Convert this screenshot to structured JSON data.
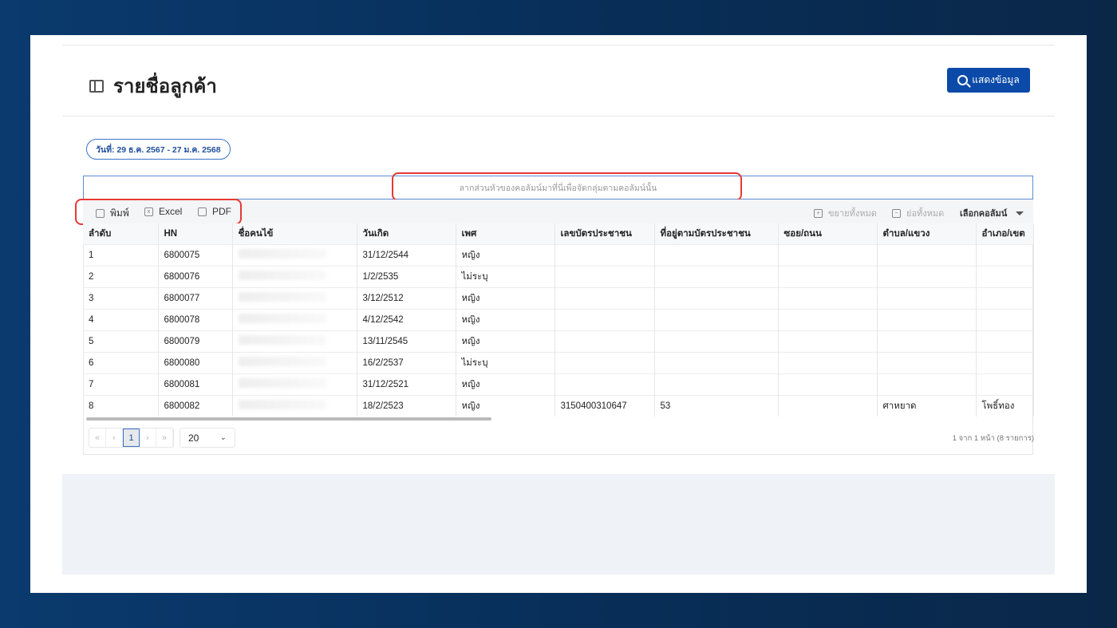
{
  "header": {
    "title": "รายชื่อลูกค้า",
    "show_button": "แสดงข้อมูล"
  },
  "date_range": "วันที่: 29 ธ.ค. 2567 - 27 ม.ค. 2568",
  "group_hint": "ลากส่วนหัวของคอลัมน์มาที่นี่เพื่อจัดกลุ่มตามคอลัมน์นั้น",
  "toolbar": {
    "print": "พิมพ์",
    "excel": "Excel",
    "pdf": "PDF",
    "expand_all": "ขยายทั้งหมด",
    "collapse_all": "ย่อทั้งหมด",
    "choose_columns": "เลือกคอลัมน์"
  },
  "columns": [
    "ลำดับ",
    "HN",
    "ชื่อคนไข้",
    "วันเกิด",
    "เพศ",
    "เลขบัตรประชาชน",
    "ที่อยู่ตามบัตรประชาชน",
    "ซอย/ถนน",
    "ตำบล/แขวง",
    "อำเภอ/เขต"
  ],
  "rows": [
    [
      "1",
      "6800075",
      "",
      "31/12/2544",
      "หญิง",
      "",
      "",
      "",
      "",
      ""
    ],
    [
      "2",
      "6800076",
      "",
      "1/2/2535",
      "ไม่ระบุ",
      "",
      "",
      "",
      "",
      ""
    ],
    [
      "3",
      "6800077",
      "",
      "3/12/2512",
      "หญิง",
      "",
      "",
      "",
      "",
      ""
    ],
    [
      "4",
      "6800078",
      "",
      "4/12/2542",
      "หญิง",
      "",
      "",
      "",
      "",
      ""
    ],
    [
      "5",
      "6800079",
      "",
      "13/11/2545",
      "หญิง",
      "",
      "",
      "",
      "",
      ""
    ],
    [
      "6",
      "6800080",
      "",
      "16/2/2537",
      "ไม่ระบุ",
      "",
      "",
      "",
      "",
      ""
    ],
    [
      "7",
      "6800081",
      "",
      "31/12/2521",
      "หญิง",
      "",
      "",
      "",
      "",
      ""
    ],
    [
      "8",
      "6800082",
      "",
      "18/2/2523",
      "หญิง",
      "3150400310647",
      "53",
      "",
      "ศาหยาด",
      "โพธิ์ทอง"
    ]
  ],
  "pager": {
    "first": "«",
    "prev": "‹",
    "page": "1",
    "next": "›",
    "last": "»",
    "page_size": "20",
    "info": "1 จาก 1 หน้า (8 รายการ)"
  }
}
